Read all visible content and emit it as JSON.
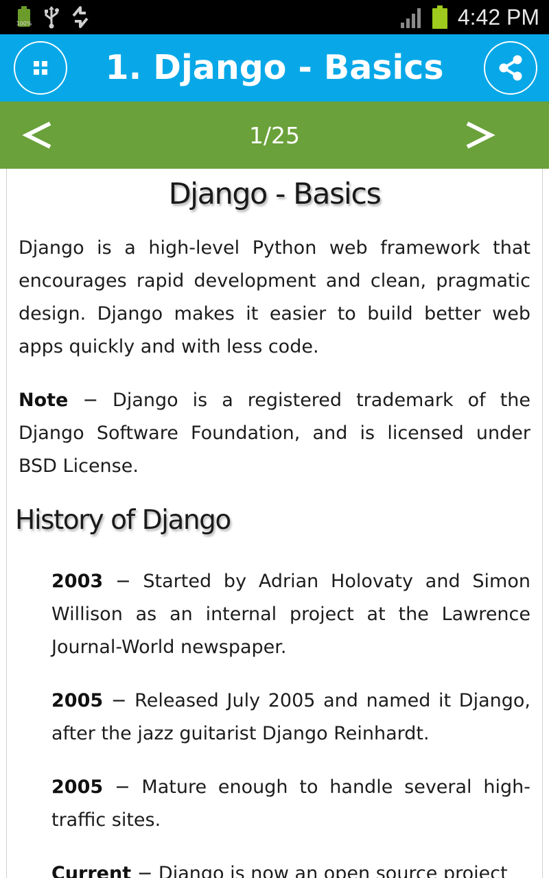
{
  "status_bar": {
    "battery_small_text": "100%",
    "time": "4:42 PM"
  },
  "app_bar": {
    "title": "1. Django - Basics",
    "menu_icon": "grid-icon",
    "share_icon": "share-icon"
  },
  "pager": {
    "prev_label": "<",
    "next_label": ">",
    "count": "1/25"
  },
  "content": {
    "title": "Django - Basics",
    "intro": "Django is a high-level Python web framework that encourages rapid development and clean, pragmatic design. Django makes it easier to build better web apps quickly and with less code.",
    "note_label": "Note",
    "note_text": " − Django is a registered trademark of the Django Software Foundation, and is licensed under BSD License.",
    "history_title": "History of Django",
    "history": [
      {
        "year": "2003",
        "text": " − Started by Adrian Holovaty and Simon Willison as an internal project at the Lawrence Journal-World newspaper."
      },
      {
        "year": "2005",
        "text": " − Released July 2005 and named it Django, after the jazz guitarist Django Reinhardt."
      },
      {
        "year": "2005",
        "text": " − Mature enough to handle several high-traffic sites."
      },
      {
        "year": "Current",
        "text": " − Django is now an open source project"
      }
    ]
  },
  "colors": {
    "app_bar": "#08a8e8",
    "pager_bar": "#6aa13a",
    "status_bar": "#000000"
  }
}
